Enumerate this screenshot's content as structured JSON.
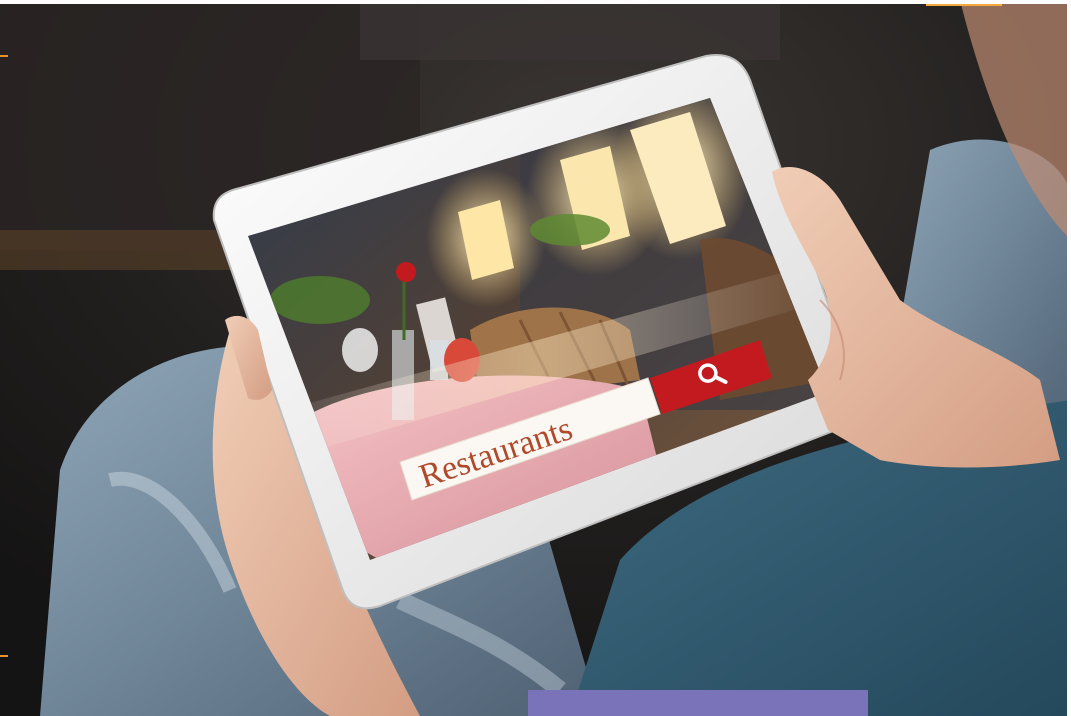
{
  "tablet_screen": {
    "search": {
      "query": "Restaurants",
      "button_icon": "magnifier-icon"
    }
  },
  "colors": {
    "search_button": "#c21a1e",
    "query_text": "#b0492a",
    "bottom_bar": "#7b73ba",
    "corner_mark": "#f4a93f"
  }
}
